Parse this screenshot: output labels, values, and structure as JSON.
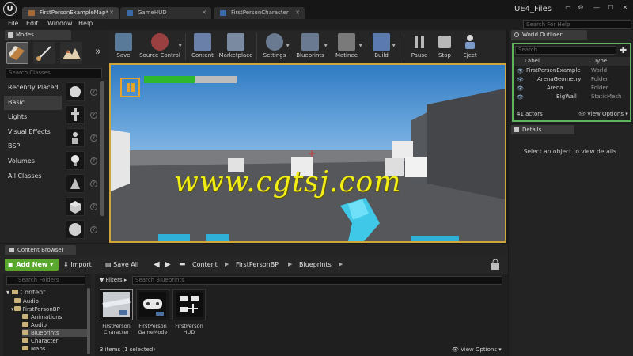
{
  "window": {
    "project_name": "UE4_Files",
    "tabs": [
      {
        "label": "FirstPersonExampleMap*",
        "icon": "map-icon",
        "color": "#a06a3a"
      },
      {
        "label": "GameHUD",
        "icon": "blueprint-icon",
        "color": "#3a6aa8"
      },
      {
        "label": "FirstPersonCharacter",
        "icon": "blueprint-icon",
        "color": "#3a6aa8"
      }
    ],
    "logo_glyph": "U"
  },
  "menubar": {
    "items": [
      "File",
      "Edit",
      "Window",
      "Help"
    ],
    "search_placeholder": "Search For Help"
  },
  "modes": {
    "tab_label": "Modes",
    "search_placeholder": "Search Classes",
    "categories": [
      "Recently Placed",
      "Basic",
      "Lights",
      "Visual Effects",
      "BSP",
      "Volumes",
      "All Classes"
    ],
    "active_category": "Basic",
    "thumb_icons": [
      "sphere-icon",
      "figure-icon",
      "pawn-icon",
      "bulb-icon",
      "trigger-icon",
      "cube-icon",
      "sphere-icon"
    ]
  },
  "toolbar": {
    "buttons": [
      {
        "label": "Save",
        "icon": "save-icon",
        "color": "#5a7a9a"
      },
      {
        "label": "Source Control",
        "icon": "source-control-icon",
        "color": "#9a4040"
      },
      {
        "label": "Content",
        "icon": "content-icon",
        "color": "#6a80a8"
      },
      {
        "label": "Marketplace",
        "icon": "marketplace-icon",
        "color": "#7a8aa0"
      },
      {
        "label": "Settings",
        "icon": "settings-icon",
        "color": "#6a7a90"
      },
      {
        "label": "Blueprints",
        "icon": "blueprints-icon",
        "color": "#6a7a90"
      },
      {
        "label": "Matinee",
        "icon": "matinee-icon",
        "color": "#7a7a7a"
      },
      {
        "label": "Build",
        "icon": "build-icon",
        "color": "#5a7ab0"
      },
      {
        "label": "Pause",
        "icon": "pause-icon",
        "color": "#b0b0b0"
      },
      {
        "label": "Stop",
        "icon": "stop-icon",
        "color": "#b0b0b0"
      },
      {
        "label": "Eject",
        "icon": "eject-icon",
        "color": "#8aa0c0"
      }
    ]
  },
  "viewport": {
    "health_fraction": 0.55,
    "health_color": "#2db82d",
    "pause_color": "#e5a32d",
    "watermark": "www.cgtsj.com",
    "border_color": "#cfa63a"
  },
  "outliner": {
    "tab_label": "World Outliner",
    "search_placeholder": "Search...",
    "columns": [
      "Label",
      "Type"
    ],
    "rows": [
      {
        "label": "FirstPersonExample",
        "type": "World",
        "depth": 0
      },
      {
        "label": "ArenaGeometry",
        "type": "Folder",
        "depth": 1
      },
      {
        "label": "Arena",
        "type": "Folder",
        "depth": 2
      },
      {
        "label": "BigWall",
        "type": "StaticMesh",
        "depth": 3
      }
    ],
    "actor_count": "41 actors",
    "view_options": "View Options",
    "highlight_color": "#5db45d"
  },
  "details": {
    "tab_label": "Details",
    "empty_message": "Select an object to view details."
  },
  "content_browser": {
    "tab_label": "Content Browser",
    "add_new": "Add New",
    "import": "Import",
    "save_all": "Save All",
    "breadcrumbs": [
      "Content",
      "FirstPersonBP",
      "Blueprints"
    ],
    "search_folders_placeholder": "Search Folders",
    "folders": [
      {
        "label": "Content",
        "depth": 0,
        "selected": false
      },
      {
        "label": "Audio",
        "depth": 1,
        "selected": false
      },
      {
        "label": "FirstPersonBP",
        "depth": 1,
        "selected": false
      },
      {
        "label": "Animations",
        "depth": 2,
        "selected": false
      },
      {
        "label": "Audio",
        "depth": 2,
        "selected": false
      },
      {
        "label": "Blueprints",
        "depth": 2,
        "selected": true
      },
      {
        "label": "Character",
        "depth": 2,
        "selected": false
      },
      {
        "label": "Maps",
        "depth": 2,
        "selected": false
      }
    ],
    "filters_label": "Filters",
    "search_assets_placeholder": "Search Blueprints",
    "assets": [
      {
        "name": "FirstPerson Character",
        "icon": "character-blueprint-icon",
        "selected": true
      },
      {
        "name": "FirstPerson GameMode",
        "icon": "gamepad-icon",
        "selected": false
      },
      {
        "name": "FirstPerson HUD",
        "icon": "hud-icon",
        "selected": false
      }
    ],
    "items_count": "3 items (1 selected)",
    "view_options": "View Options",
    "add_new_color": "#5aa72e"
  }
}
